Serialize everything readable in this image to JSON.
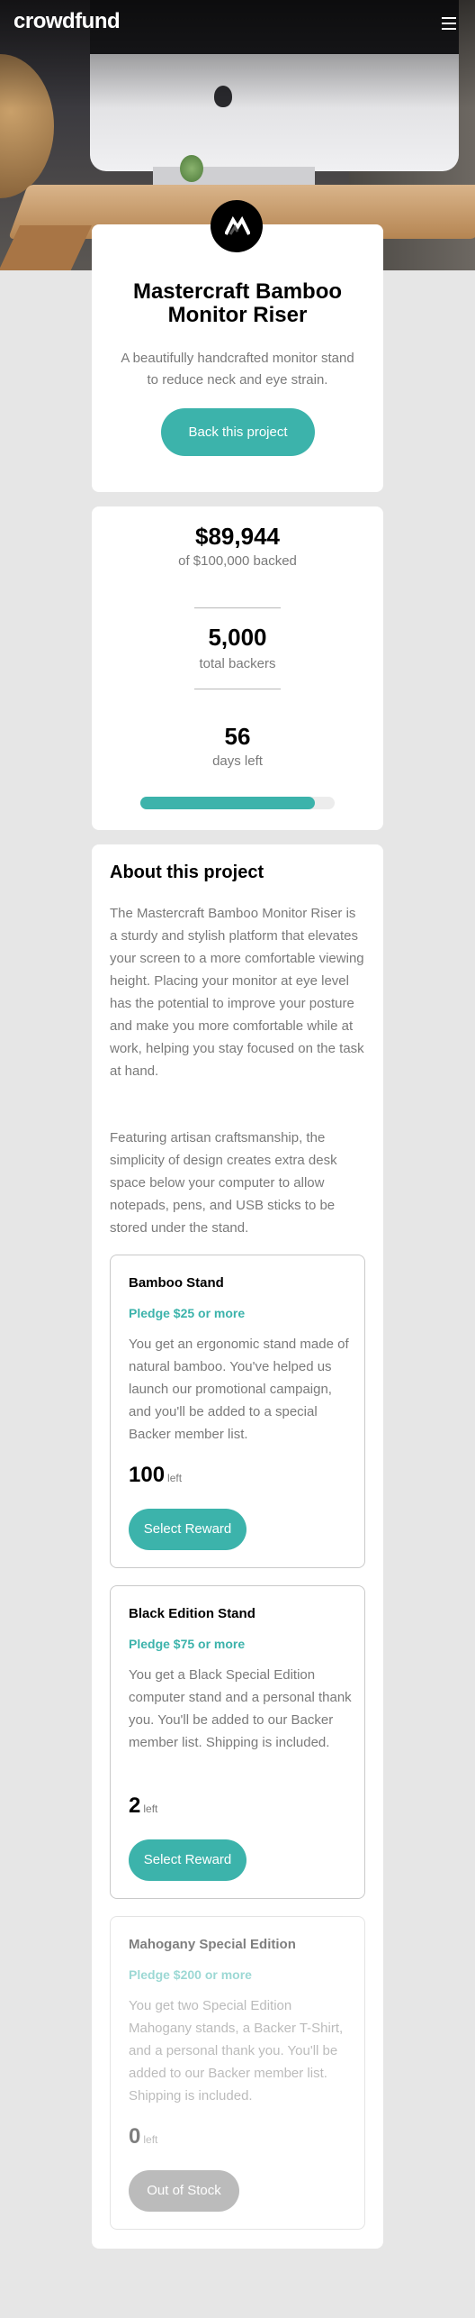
{
  "header": {
    "logo": "crowdfund"
  },
  "hero_card": {
    "title": "Mastercraft Bamboo Monitor Riser",
    "subtitle": "A beautifully handcrafted monitor stand to reduce neck and eye strain.",
    "back_button": "Back this project"
  },
  "stats": {
    "backed_amount": "$89,944",
    "backed_label": "of $100,000 backed",
    "backers_count": "5,000",
    "backers_label": "total backers",
    "days_count": "56",
    "days_label": "days left",
    "progress_fraction": 0.899
  },
  "about": {
    "title": "About this project",
    "paragraphs": [
      "The Mastercraft Bamboo Monitor Riser is a sturdy and stylish platform that elevates your screen to a more comfortable viewing height. Placing your monitor at eye level has the potential to improve your posture and make you more comfortable while at work, helping you stay focused on the task at hand.",
      "Featuring artisan craftsmanship, the simplicity of design creates extra desk space below your computer to allow notepads, pens, and USB sticks to be stored under the stand."
    ]
  },
  "rewards": [
    {
      "name": "Bamboo Stand",
      "pledge": "Pledge $25 or more",
      "description": "You get an ergonomic stand made of natural bamboo. You've helped us launch our promotional campaign, and you'll be added to a special Backer member list.",
      "left_count": "100",
      "left_label": "left",
      "button": "Select Reward"
    },
    {
      "name": "Black Edition Stand",
      "pledge": "Pledge $75 or more",
      "description": "You get a Black Special Edition computer stand and a personal thank you. You'll be added to our Backer member list. Shipping is included.",
      "left_count": "2",
      "left_label": "left",
      "button": "Select Reward"
    },
    {
      "name": "Mahogany Special Edition",
      "pledge": "Pledge $200 or more",
      "description": "You get two Special Edition Mahogany stands, a Backer T-Shirt, and a personal thank you. You'll be added to our Backer member list. Shipping is included.",
      "left_count": "0",
      "left_label": "left",
      "button": "Out of Stock"
    }
  ],
  "colors": {
    "accent": "#3cb3ab",
    "text_muted": "#7a7a7a",
    "background": "#e6e6e6"
  },
  "icons": {
    "menu": "hamburger-icon",
    "brand": "mastercraft-logo-icon"
  }
}
